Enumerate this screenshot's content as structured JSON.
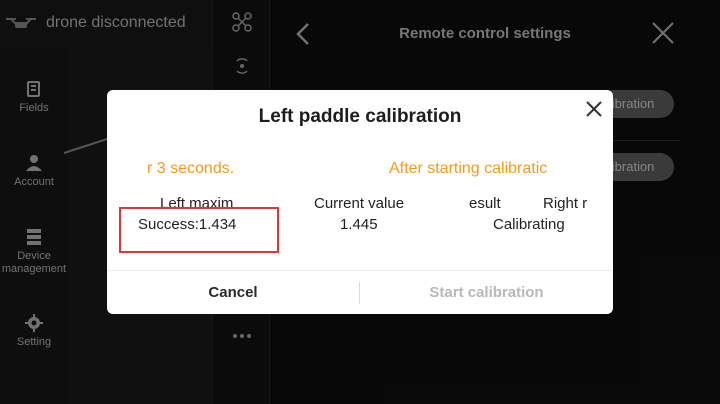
{
  "topbar": {
    "drone_status": "drone disconnected"
  },
  "sidebar": {
    "items": [
      {
        "label": "Fields",
        "icon": "fields-icon"
      },
      {
        "label": "Account",
        "icon": "user-icon"
      },
      {
        "label": "Device management",
        "icon": "device-icon"
      },
      {
        "label": "Setting",
        "icon": "gear-icon"
      }
    ]
  },
  "main": {
    "title": "Remote control settings",
    "pill_1": "llibration",
    "pill_2": "llibration"
  },
  "dialog": {
    "title": "Left paddle calibration",
    "hint_left": "r 3 seconds.",
    "hint_right": "After starting calibratic",
    "columns": {
      "left_max_header": "Left maxim",
      "current_header": "Current value",
      "result_header": "esult",
      "right_header": "Right r"
    },
    "values": {
      "left_max": "Success:1.434",
      "current": "1.445",
      "result": "Calibrating"
    },
    "cancel_label": "Cancel",
    "start_label": "Start calibration"
  },
  "colors": {
    "hint_orange": "#f39a1e",
    "highlight_red": "#d63a3a",
    "disabled_text": "#b8b8b8"
  }
}
